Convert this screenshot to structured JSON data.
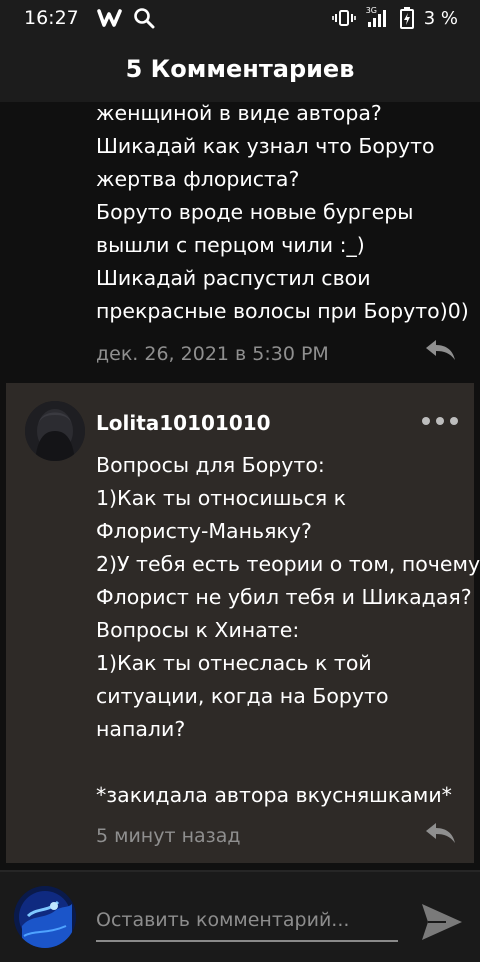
{
  "status_bar": {
    "time": "16:27",
    "network": "3G",
    "battery": "3 %"
  },
  "header": {
    "title": "5 Комментариев"
  },
  "comments": [
    {
      "text": "женщиной в виде автора?\nШикадай как узнал что Боруто\nжертва флориста?\nБоруто вроде новые бургеры\nвышли с перцом чили :_)\nШикадай распустил свои\nпрекрасные волосы при Боруто)0)",
      "timestamp": "дек. 26, 2021 в 5:30 PM"
    },
    {
      "username": "Lolita10101010",
      "text": "Вопросы для Боруто:\n1)Как ты относишься к\nФлористу-Маньяку?\n2)У тебя есть теории о том, почему\nФлорист не убил тебя и Шикадая?\nВопросы к Хинате:\n1)Как ты отнеслась к той\nситуации, когда на Боруто\nнапали?\n\n*закидала автора вкусняшками*",
      "timestamp": "5 минут назад"
    }
  ],
  "composer": {
    "placeholder": "Оставить комментарий..."
  },
  "colors": {
    "background": "#101010",
    "bar": "#1c1c1c",
    "highlight_card": "#2e2a27",
    "muted_text": "#8f8f8f"
  },
  "icons": [
    "w-app-icon",
    "search-icon",
    "vibrate-icon",
    "signal-icon",
    "battery-icon",
    "reply-icon",
    "more-icon",
    "send-icon"
  ]
}
